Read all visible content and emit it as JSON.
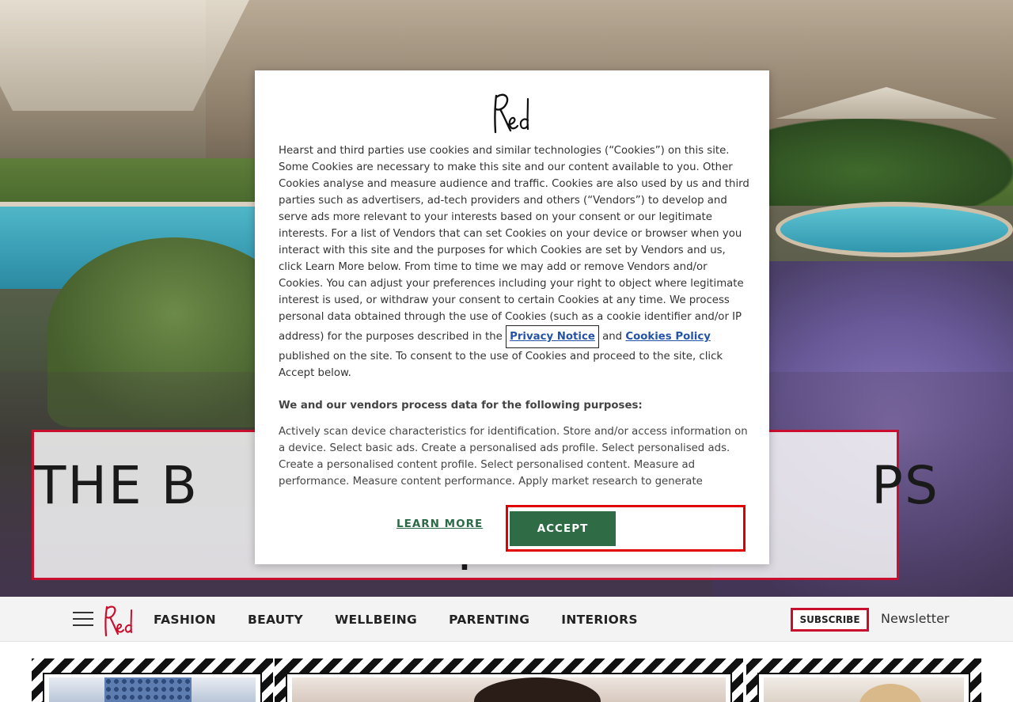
{
  "hero": {
    "title_line1": "THE B                                     PS",
    "title_line2": "I"
  },
  "nav": {
    "menu_icon": "hamburger-menu-icon",
    "logo_text": "Red",
    "links": [
      "FASHION",
      "BEAUTY",
      "WELLBEING",
      "PARENTING",
      "INTERIORS"
    ],
    "subscribe_label": "SUBSCRIBE",
    "newsletter_label": "Newsletter"
  },
  "cookie_modal": {
    "logo_text": "Red",
    "body_before": "Hearst and third parties use cookies and similar technologies (“Cookies”) on this site. Some Cookies are necessary to make this site and our content available to you. Other Cookies analyse and measure audience and traffic. Cookies are also used by us and third parties such as advertisers, ad-tech providers and others (“Vendors”) to develop and serve ads more relevant to your interests based on your consent or our legitimate interests. For a list of Vendors that can set Cookies on your device or browser when you interact with this site and the purposes for which Cookies are set by Vendors and us, click Learn More below. From time to time we may add or remove Vendors and/or Cookies. You can adjust your preferences including your right to object where legitimate interest is used, or withdraw your consent to certain Cookies at any time. We process personal data obtained through the use of Cookies (such as a cookie identifier and/or IP address) for the purposes described in the ",
    "privacy_link": "Privacy Notice",
    "and_text": " and ",
    "cookies_link": "Cookies Policy",
    "body_after": " published on the site. To consent to the use of Cookies and proceed to the site, click Accept below.",
    "purposes_heading": "We and our vendors process data for the following purposes:",
    "purposes_text": "Actively scan device characteristics for identification. Store and/or access information on a device. Select basic ads. Create a personalised ads profile. Select personalised ads. Create a personalised content profile. Select personalised content. Measure ad performance. Measure content performance. Apply market research to generate audience insights. Develop and improve products.",
    "learn_more_label": "LEARN MORE",
    "accept_label": "ACCEPT"
  },
  "colors": {
    "brand_red": "#c8102e",
    "accept_green": "#2f6b45",
    "link_blue": "#2553a8",
    "highlight_red": "#e00000"
  }
}
